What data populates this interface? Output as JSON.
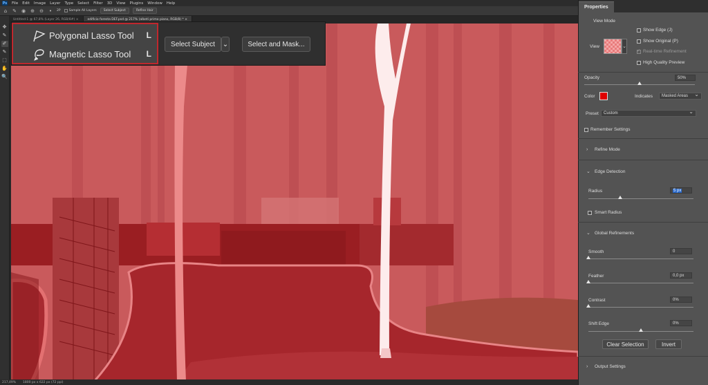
{
  "menubar": {
    "logo": "Ps",
    "items": [
      "File",
      "Edit",
      "Image",
      "Layer",
      "Type",
      "Select",
      "Filter",
      "3D",
      "View",
      "Plugins",
      "Window",
      "Help"
    ]
  },
  "options": {
    "sample_all_layers": "Sample All Layers",
    "select_subject": "Select Subject",
    "refine_hair": "Refine Hair",
    "size_value": "2P"
  },
  "tabs": [
    {
      "label": "Untitled-1 @ 67,8% (Layer 26, RGB/8#) ×"
    },
    {
      "label": "edificio foresta DEF.psd @ 217% (albeti primo piano, RGB/8) * ×"
    }
  ],
  "flyout": {
    "items": [
      {
        "label": "Polygonal Lasso Tool",
        "shortcut": "L",
        "icon": "polygonal-lasso-icon"
      },
      {
        "label": "Magnetic Lasso Tool",
        "shortcut": "L",
        "icon": "magnetic-lasso-icon"
      }
    ],
    "select_subject": "Select Subject",
    "select_and_mask": "Select and Mask..."
  },
  "status": {
    "zoom": "217,49%",
    "doc_size": "1800 px x 622 px (72 ppi)"
  },
  "properties": {
    "tab": "Properties",
    "view_mode": {
      "title": "View Mode",
      "view_label": "View",
      "show_edge": "Show Edge (J)",
      "show_original": "Show Original (P)",
      "realtime": "Real-time Refinement",
      "hq_preview": "High Quality Preview"
    },
    "opacity": {
      "label": "Opacity",
      "value": "50%",
      "level": 0.5
    },
    "color": {
      "label": "Color",
      "swatch": "#e00000",
      "indicates_label": "Indicates",
      "indicates_value": "Masked Areas"
    },
    "preset": {
      "label": "Preset",
      "value": "Custom"
    },
    "remember": "Remember Settings",
    "refine_mode": "Refine Mode",
    "edge_detection": {
      "title": "Edge Detection",
      "radius_label": "Radius",
      "radius_value": "5 px",
      "radius_level": 0.05,
      "smart_radius": "Smart Radius"
    },
    "global": {
      "title": "Global Refinements",
      "smooth_label": "Smooth",
      "smooth_value": "0",
      "smooth_level": 0,
      "feather_label": "Feather",
      "feather_value": "0,0 px",
      "feather_level": 0,
      "contrast_label": "Contrast",
      "contrast_value": "0%",
      "contrast_level": 0,
      "shift_label": "Shift Edge",
      "shift_value": "0%",
      "shift_level": 0.5,
      "clear_selection": "Clear Selection",
      "invert": "Invert"
    },
    "output": "Output Settings"
  }
}
